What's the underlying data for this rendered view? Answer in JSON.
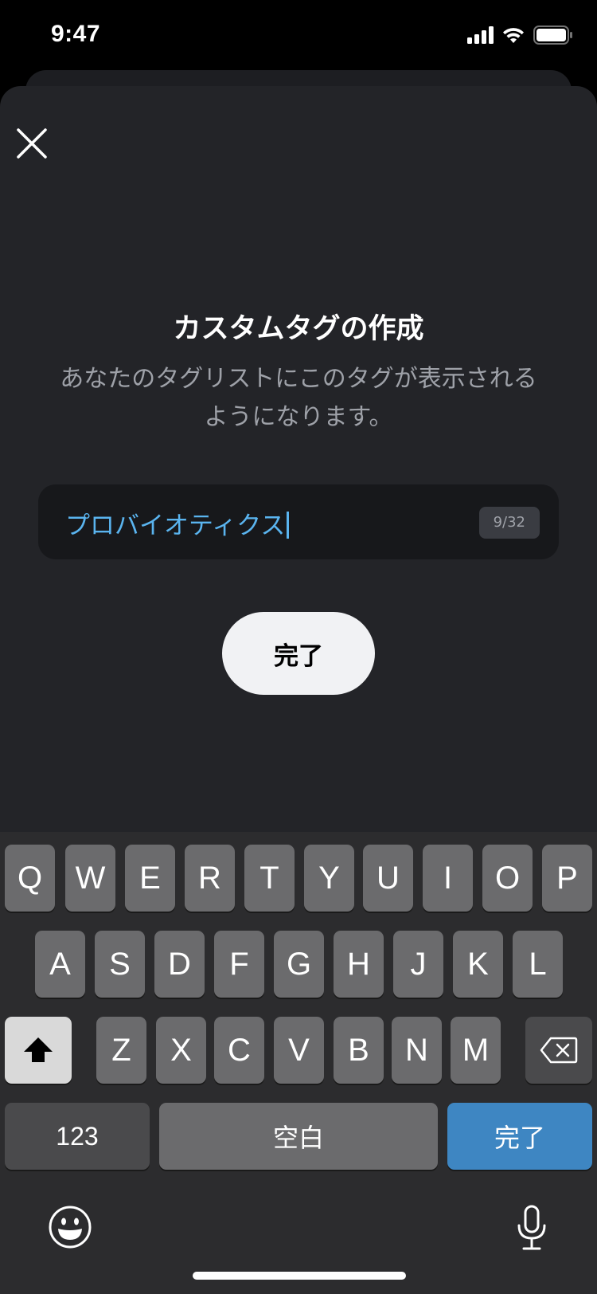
{
  "status_bar": {
    "time": "9:47"
  },
  "sheet": {
    "title": "カスタムタグの作成",
    "subtitle_line1": "あなたのタグリストにこのタグが表示される",
    "subtitle_line2": "ようになります。",
    "input": {
      "value": "プロバイオティクス",
      "counter": "9/32"
    },
    "done_button": "完了"
  },
  "keyboard": {
    "row1": [
      "Q",
      "W",
      "E",
      "R",
      "T",
      "Y",
      "U",
      "I",
      "O",
      "P"
    ],
    "row2": [
      "A",
      "S",
      "D",
      "F",
      "G",
      "H",
      "J",
      "K",
      "L"
    ],
    "row3": [
      "Z",
      "X",
      "C",
      "V",
      "B",
      "N",
      "M"
    ],
    "numbers_key": "123",
    "space_key": "空白",
    "return_key": "完了"
  },
  "colors": {
    "accent_text": "#5ab4ef",
    "return_key": "#3e86c2",
    "sheet_bg": "#232428"
  }
}
